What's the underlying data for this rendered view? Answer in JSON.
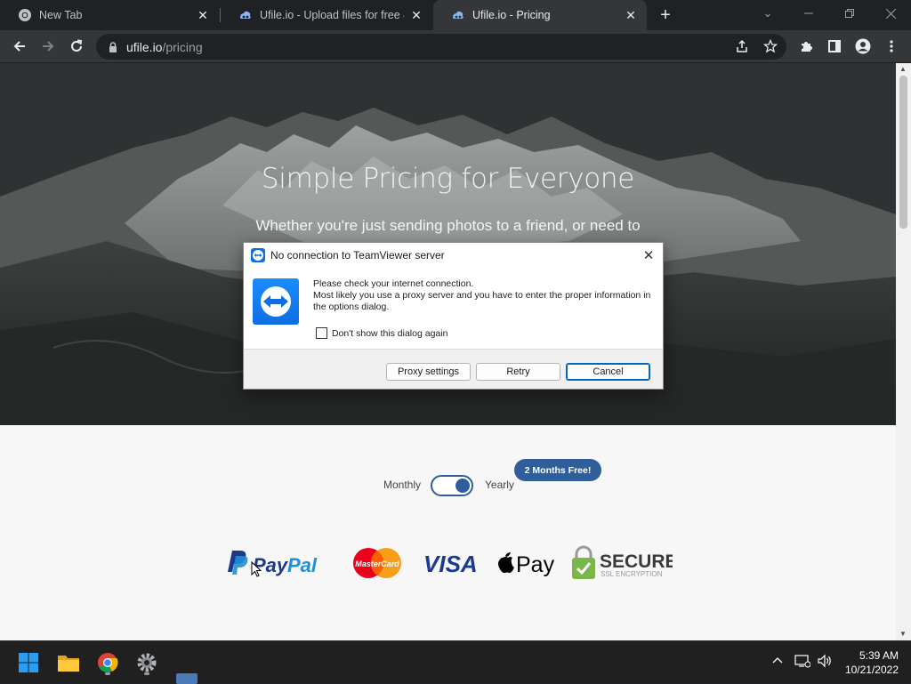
{
  "browser": {
    "tabs": [
      {
        "title": "New Tab",
        "favicon": "chrome-icon",
        "active": false
      },
      {
        "title": "Ufile.io - Upload files for free & s",
        "favicon": "ufile-icon",
        "active": false
      },
      {
        "title": "Ufile.io - Pricing",
        "favicon": "ufile-icon",
        "active": true
      }
    ],
    "url_host": "ufile.io",
    "url_path": "/pricing"
  },
  "page": {
    "hero_title": "Simple Pricing for Everyone",
    "hero_subtitle": "Whether you're just sending photos to a friend, or need to backup your business, we have you covered.",
    "billing": {
      "monthly_label": "Monthly",
      "yearly_label": "Yearly",
      "promo_badge": "2 Months Free!",
      "yearly_selected": true
    },
    "payment_logos": [
      "PayPal",
      "MasterCard",
      "VISA",
      "Apple Pay",
      "SECURE"
    ],
    "secure_line1": "SECURE",
    "secure_line2": "SSL ENCRYPTION"
  },
  "dialog": {
    "title": "No connection to TeamViewer server",
    "line1": "Please check your internet connection.",
    "line2": "Most likely you use a proxy server and you have to enter the proper information in the options dialog.",
    "checkbox_label": "Don't show this dialog again",
    "buttons": {
      "proxy": "Proxy settings",
      "retry": "Retry",
      "cancel": "Cancel"
    }
  },
  "taskbar": {
    "time": "5:39 AM",
    "date": "10/21/2022",
    "pinned": [
      "windows-start-icon",
      "file-explorer-icon",
      "chrome-icon",
      "settings-icon"
    ]
  },
  "colors": {
    "accent": "#2f5e9b",
    "teamviewer": "#0e6ee2",
    "chrome_dark": "#202124",
    "toolbar": "#35363a"
  }
}
